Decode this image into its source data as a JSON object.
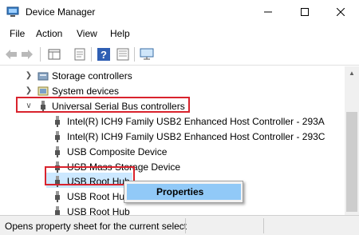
{
  "window": {
    "title": "Device Manager",
    "controls": {
      "minimize": "minimize-icon",
      "maximize": "maximize-icon",
      "close": "close-icon"
    }
  },
  "menu": [
    "File",
    "Action",
    "View",
    "Help"
  ],
  "toolbar": {
    "buttons": [
      "back-arrow-icon",
      "forward-arrow-icon",
      "properties-grid-icon",
      "details-page-icon",
      "help-question-icon",
      "scan-hardware-icon",
      "monitor-icon"
    ]
  },
  "tree": {
    "items": [
      {
        "label": "Storage controllers",
        "icon": "storage-controller-icon",
        "expander": "collapsed"
      },
      {
        "label": "System devices",
        "icon": "system-devices-icon",
        "expander": "collapsed"
      },
      {
        "label": "Universal Serial Bus controllers",
        "icon": "usb-controller-icon",
        "expander": "expanded"
      },
      {
        "label": "Intel(R) ICH9 Family USB2 Enhanced Host Controller - 293A",
        "icon": "usb-plug-icon"
      },
      {
        "label": "Intel(R) ICH9 Family USB2 Enhanced Host Controller - 293C",
        "icon": "usb-plug-icon"
      },
      {
        "label": "USB Composite Device",
        "icon": "usb-plug-icon"
      },
      {
        "label": "USB Mass Storage Device",
        "icon": "usb-plug-icon"
      },
      {
        "label": "USB Root Hub",
        "icon": "usb-plug-icon",
        "selected": true
      },
      {
        "label": "USB Root Hub",
        "icon": "usb-plug-icon"
      },
      {
        "label": "USB Root Hub",
        "icon": "usb-plug-icon"
      }
    ]
  },
  "context_menu": {
    "items": [
      "Properties"
    ]
  },
  "status_bar": {
    "text": "Opens property sheet for the current select"
  },
  "colors": {
    "highlight_box": "#d9232d",
    "selection": "#cce8ff",
    "context_hover": "#91c9f7"
  }
}
